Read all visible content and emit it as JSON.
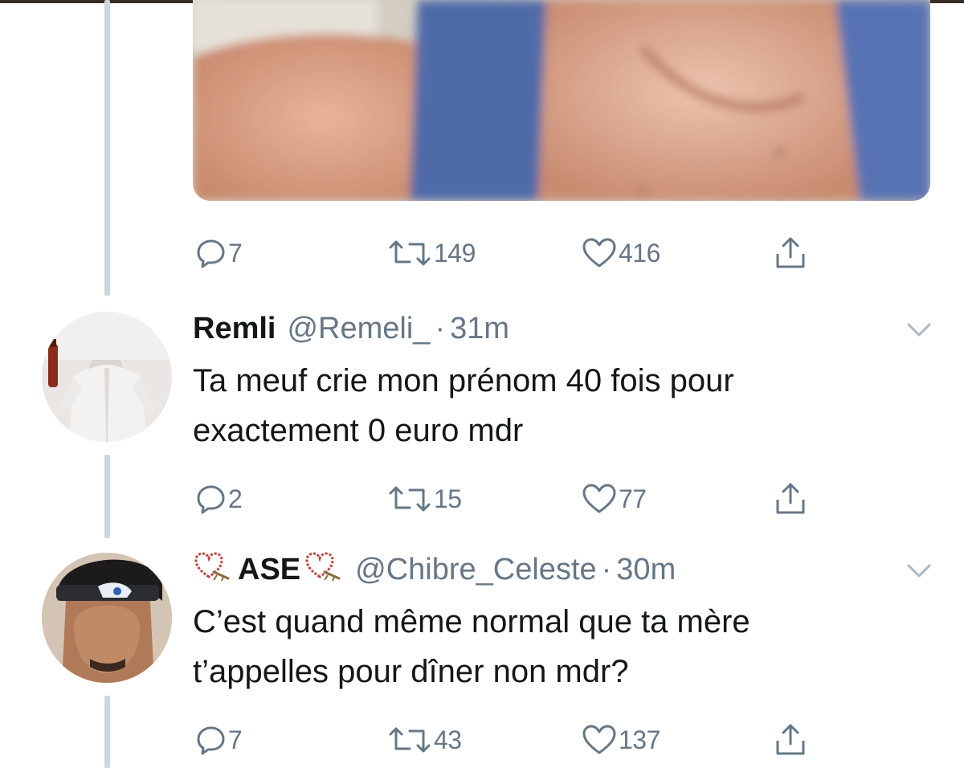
{
  "tweets": [
    {
      "actions": {
        "replies": "7",
        "retweets": "149",
        "likes": "416"
      }
    },
    {
      "display_name": "Remli",
      "handle": "@Remeli_",
      "separator": "·",
      "time": "31m",
      "text_line1": "Ta meuf crie mon prénom 40 fois pour",
      "text_line2": "exactement 0 euro mdr",
      "actions": {
        "replies": "2",
        "retweets": "15",
        "likes": "77"
      }
    },
    {
      "display_name": "ASE",
      "handle": "@Chibre_Celeste",
      "separator": "·",
      "time": "30m",
      "text_line1": "C’est quand même normal que ta mère",
      "text_line2": "t’appelles pour dîner non mdr?",
      "actions": {
        "replies": "7",
        "retweets": "43",
        "likes": "137"
      }
    }
  ],
  "icons": {
    "reply": "reply-icon",
    "retweet": "retweet-icon",
    "like": "heart-icon",
    "share": "share-icon",
    "menu": "chevron-down-icon",
    "name_decoration": "heart-emoji-icon"
  },
  "colors": {
    "text": "#14171a",
    "muted": "#657786",
    "thread_line": "#ccd6dd",
    "caret": "#aab8c2"
  }
}
